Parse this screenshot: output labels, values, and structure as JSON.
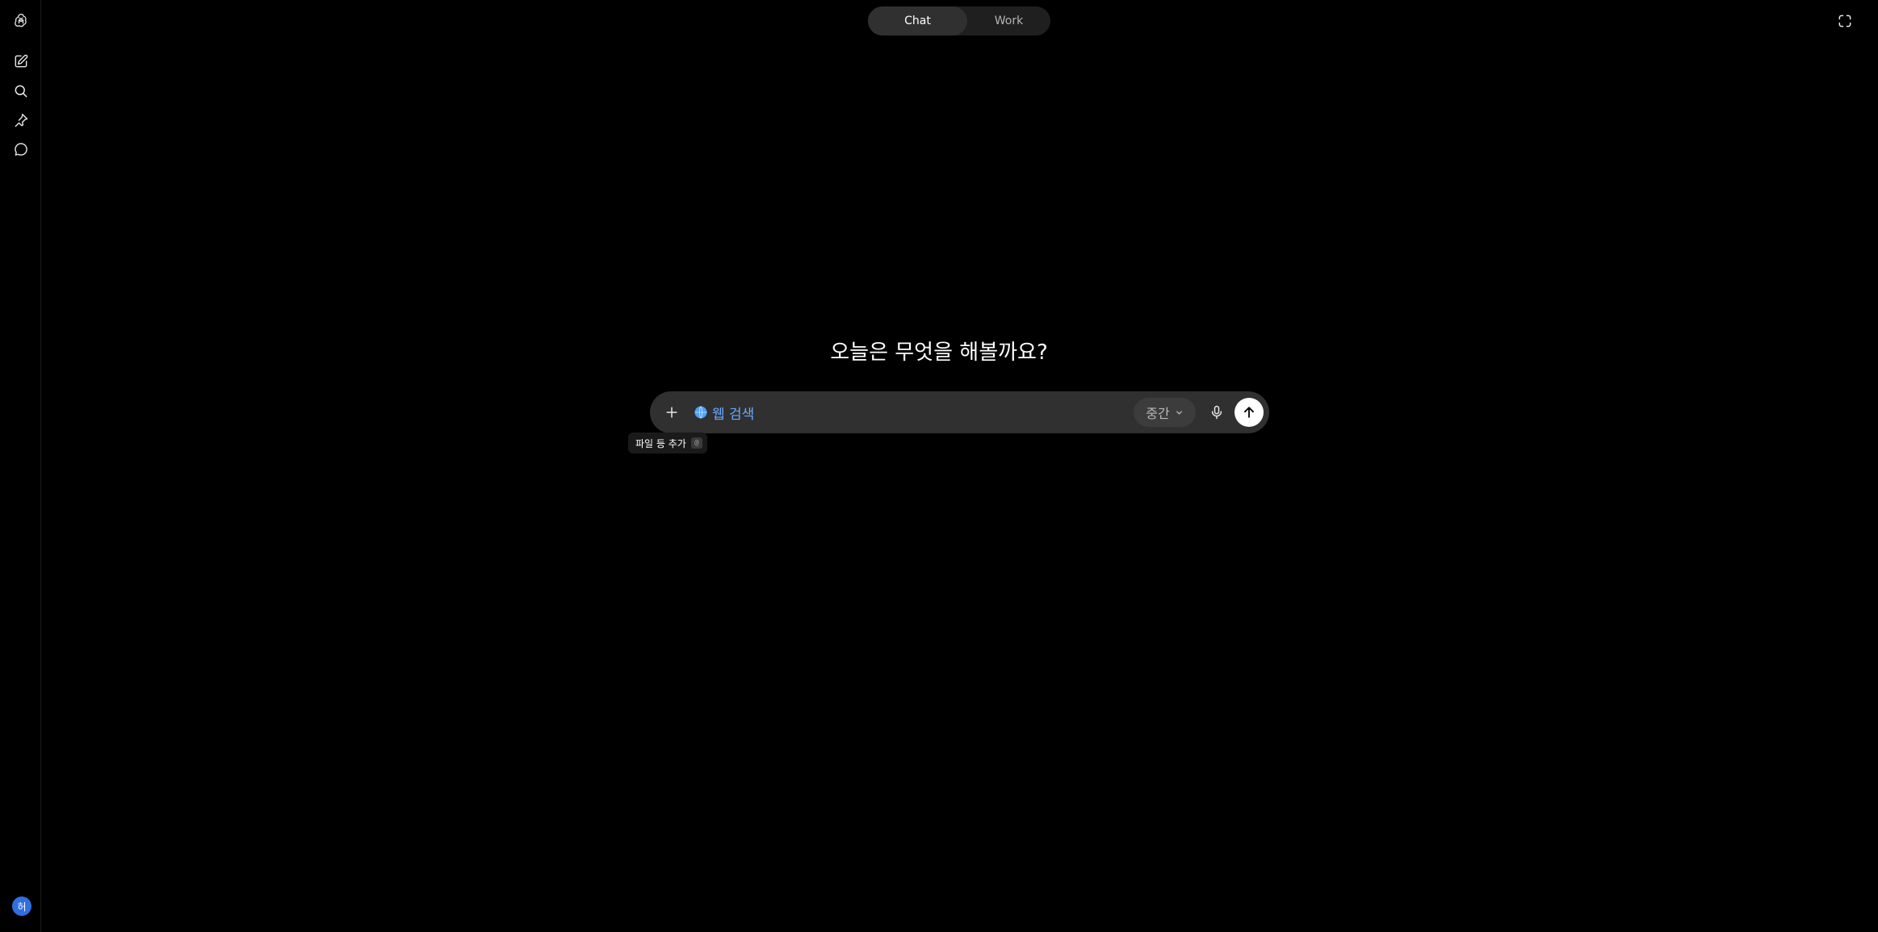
{
  "mode_toggle": {
    "chat_label": "Chat",
    "work_label": "Work",
    "active": "Chat"
  },
  "sidebar": {
    "items": [
      {
        "icon": "openai-logo-icon"
      },
      {
        "icon": "new-chat-icon"
      },
      {
        "icon": "search-icon"
      },
      {
        "icon": "pin-icon"
      },
      {
        "icon": "chat-bubble-icon"
      }
    ],
    "avatar_initial": "허"
  },
  "main": {
    "headline": "오늘은 무엇을 해볼까요?"
  },
  "composer": {
    "search_chip_label": "웹 검색",
    "model_select_label": "중간",
    "tooltip_text": "파일 등 추가",
    "tooltip_shortcut": "@"
  },
  "colors": {
    "background": "#000000",
    "composer_bg": "#303030",
    "accent_blue": "#6aa8ff",
    "avatar_bg": "#2f6fe0"
  }
}
